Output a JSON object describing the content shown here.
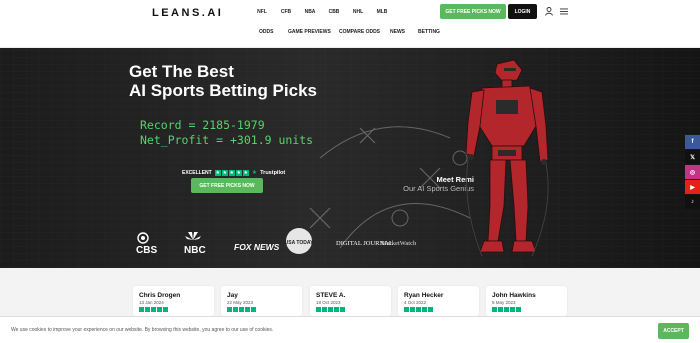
{
  "header": {
    "logo": "LEANS.AI",
    "sports": [
      "NFL",
      "CFB",
      "NBA",
      "CBB",
      "NHL",
      "MLB"
    ],
    "cta_label": "GET FREE PICKS NOW",
    "login_label": "LOGIN",
    "user_icon": "user-icon",
    "menu_icon": "menu-icon"
  },
  "subnav": [
    "ODDS",
    "GAME PREVIEWS",
    "COMPARE ODDS",
    "NEWS",
    "BETTING"
  ],
  "hero": {
    "headline_line1": "Get The Best",
    "headline_line2": "AI Sports Betting Picks",
    "code_line1": "Record = 2185-1979",
    "code_line2": "Net_Profit = +301.9 units",
    "trust_excellent": "EXCELLENT",
    "trust_brand": "Trustpilot",
    "cta_label": "GET FREE PICKS NOW",
    "meet_name": "Meet Remi",
    "meet_sub": "Our AI Sports Genius",
    "media_logos": [
      "CBS",
      "NBC",
      "FOX NEWS",
      "USA TODAY",
      "DIGITAL JOURNAL",
      "MarketWatch"
    ]
  },
  "social": [
    {
      "icon": "facebook-icon",
      "glyph": "f",
      "color": "#3b5998"
    },
    {
      "icon": "x-icon",
      "glyph": "𝕏",
      "color": "#111111"
    },
    {
      "icon": "instagram-icon",
      "glyph": "◎",
      "color": "#c13584"
    },
    {
      "icon": "youtube-icon",
      "glyph": "▶",
      "color": "#e62117"
    },
    {
      "icon": "tiktok-icon",
      "glyph": "♪",
      "color": "#111111"
    }
  ],
  "reviews": [
    {
      "name": "Chris Drogen",
      "date": "13 Jan 2024"
    },
    {
      "name": "Jay",
      "date": "22 May 2023"
    },
    {
      "name": "STEVE A.",
      "date": "18 Oct 2023"
    },
    {
      "name": "Ryan Hecker",
      "date": "4 Oct 2022"
    },
    {
      "name": "John Hawkins",
      "date": "5 May 2023"
    }
  ],
  "cookie": {
    "text": "We use cookies to improve your experience on our website. By browsing this website, you agree to our use of cookies.",
    "accept_label": "ACCEPT"
  },
  "colors": {
    "accent": "#5cb85c",
    "trustpilot": "#00b67a",
    "code": "#56d36c"
  }
}
